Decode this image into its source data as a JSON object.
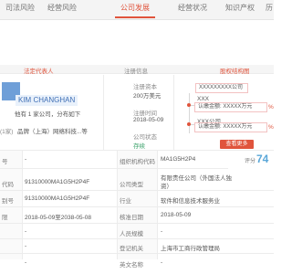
{
  "nav": {
    "items": [
      "司法风险",
      "经营风险",
      "公司发展",
      "经营状况",
      "知识产权",
      "历"
    ],
    "active_index": 2
  },
  "legal_rep": {
    "section_title": "法定代表人",
    "name": "KIM CHANGHAN",
    "related_line": "他有 1 家公司，分布如下",
    "side_label": "(1家)",
    "company_snippet": "品牌（上海）网络科技...等"
  },
  "registration": {
    "section_title": "注册信息",
    "capital_label": "注册资本",
    "capital_value": "200万美元",
    "date_label": "注册时间",
    "date_value": "2018-05-09",
    "status_label": "公司状态",
    "status_value": "存续"
  },
  "equity": {
    "section_title": "股权结构图",
    "top_entity": "XXXXXXXXX公司",
    "mid_label": "XXX",
    "mid_subtext": "认缴金额: XXXXX万元",
    "bottom_label": "XXX公司",
    "bottom_subtext": "认缴金额: XXXXX万元",
    "percent_mark": "%",
    "view_button": "查看更多"
  },
  "table": {
    "rows": [
      {
        "left_label": "号",
        "left_value": "-",
        "right_label": "组织机构代码",
        "right_value": "MA1G5H2P4"
      },
      {
        "left_label": "代码",
        "left_value": "91310000MA1G5H2P4F",
        "right_label": "公司类型",
        "right_value": "有限责任公司（外国法人独资）"
      },
      {
        "left_label": "别号",
        "left_value": "91310000MA1G5H2P4F",
        "right_label": "行业",
        "right_value": "软件和信息技术服务业"
      },
      {
        "left_label": "限",
        "left_value": "2018-05-09至2038-05-08",
        "right_label": "核准日期",
        "right_value": "2018-05-09"
      },
      {
        "left_label": "",
        "left_value": "-",
        "right_label": "人员规模",
        "right_value": "-"
      },
      {
        "left_label": "",
        "left_value": "-",
        "right_label": "登记机关",
        "right_value": "上海市工商行政管理局"
      },
      {
        "left_label": "",
        "left_value": "-",
        "right_label": "英文名称",
        "right_value": "-"
      }
    ]
  },
  "score": {
    "label": "评分",
    "value": "74"
  },
  "colors": {
    "accent": "#e0543c",
    "link": "#3f6fb5",
    "status_green": "#38a169",
    "score_blue": "#5aa7d8"
  }
}
